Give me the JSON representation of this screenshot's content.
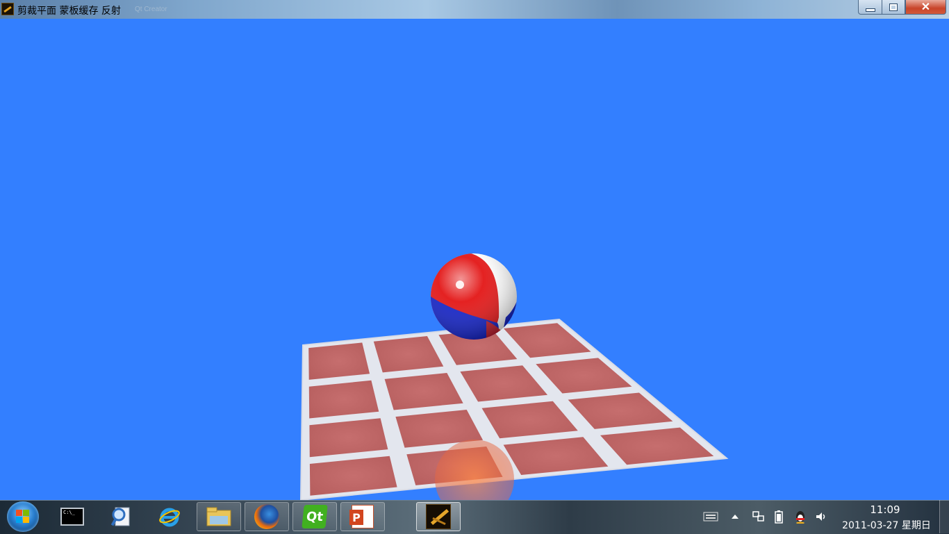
{
  "window": {
    "title": "剪裁平面 蒙板缓存 反射",
    "title_faded_suffix": "Qt Creator",
    "buttons": {
      "close_glyph": "✕"
    }
  },
  "scene": {
    "background_color": "#337fff",
    "floor": {
      "rows": 4,
      "cols": 4,
      "tile_color": "#c06868",
      "grout_color": "#e8e8ee"
    },
    "ball": {
      "colors": [
        "#e01010",
        "#ffffff",
        "#1020c0"
      ]
    }
  },
  "taskbar": {
    "pinned": [
      {
        "name": "command-prompt",
        "icon": "cmd-icon",
        "glyph": "C:\\_"
      },
      {
        "name": "search-docs",
        "icon": "search-doc-icon"
      },
      {
        "name": "internet-explorer",
        "icon": "ie-icon"
      },
      {
        "name": "windows-explorer",
        "icon": "folder-icon"
      },
      {
        "name": "firefox",
        "icon": "firefox-icon"
      },
      {
        "name": "qt-creator",
        "icon": "qt-icon",
        "glyph": "Qt"
      },
      {
        "name": "powerpoint",
        "icon": "powerpoint-icon",
        "glyph": "P"
      },
      {
        "name": "opengl-app",
        "icon": "dragon-icon"
      }
    ],
    "tray": {
      "time": "11:09",
      "date": "2011-03-27 星期日"
    }
  }
}
